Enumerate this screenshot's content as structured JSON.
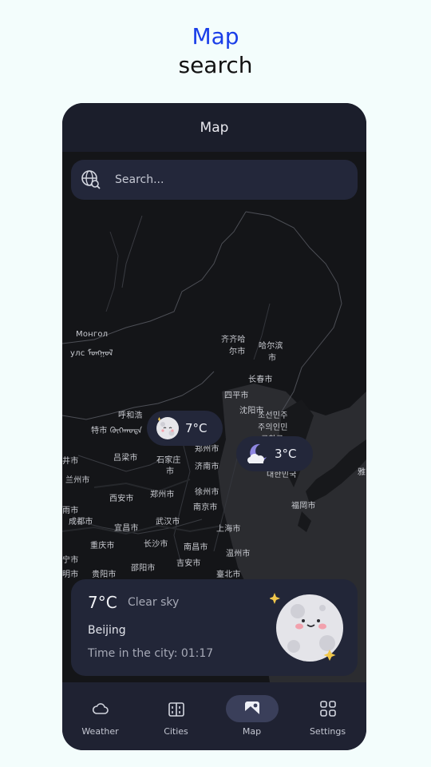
{
  "promo": {
    "title": "Map",
    "subtitle": "search"
  },
  "appbar": {
    "title": "Map"
  },
  "search": {
    "placeholder": "Search...",
    "icon": "globe-search-icon"
  },
  "map_labels": [
    "Монгол",
    "улс ᠮᠣᠩᠭᠣᠯ",
    "齐齐哈",
    "尔市",
    "哈尔滨",
    "市",
    "长春市",
    "四平市",
    "呼和浩",
    "特市 ᠬᠥᠬᠡᠬᠣᠲᠠ",
    "沈阳市",
    "조선민주",
    "주의인민",
    "공화국",
    "郑州市",
    "吕梁市",
    "石家庄",
    "市",
    "济南市",
    "兰州市",
    "西安市",
    "郑州市",
    "徐州市",
    "南京市",
    "대한민국",
    "福岡市",
    "成都市",
    "宜昌市",
    "武汉市",
    "上海市",
    "重庆市",
    "长沙市",
    "南昌市",
    "温州市",
    "贵阳市",
    "邵阳市",
    "吉安市",
    "臺北市",
    "明市",
    "宁市",
    "井市",
    "雨市",
    "雅市"
  ],
  "markers": [
    {
      "temp": "7°C",
      "icon": "moon-face-icon"
    },
    {
      "temp": "3°C",
      "icon": "moon-cloud-icon"
    }
  ],
  "card": {
    "temp": "7°C",
    "condition": "Clear sky",
    "city": "Beijing",
    "time": "Time in the city: 01:17",
    "icon": "full-moon-face-icon"
  },
  "nav": [
    {
      "label": "Weather",
      "icon": "cloud-icon",
      "active": false
    },
    {
      "label": "Cities",
      "icon": "buildings-icon",
      "active": false
    },
    {
      "label": "Map",
      "icon": "map-icon",
      "active": true
    },
    {
      "label": "Settings",
      "icon": "grid-icon",
      "active": false
    }
  ],
  "colors": {
    "accent": "#1a3ee8",
    "background": "#f3fdfc",
    "phone": "#1b1e2b",
    "card": "#222638",
    "nav_active": "#3a3f5a"
  }
}
